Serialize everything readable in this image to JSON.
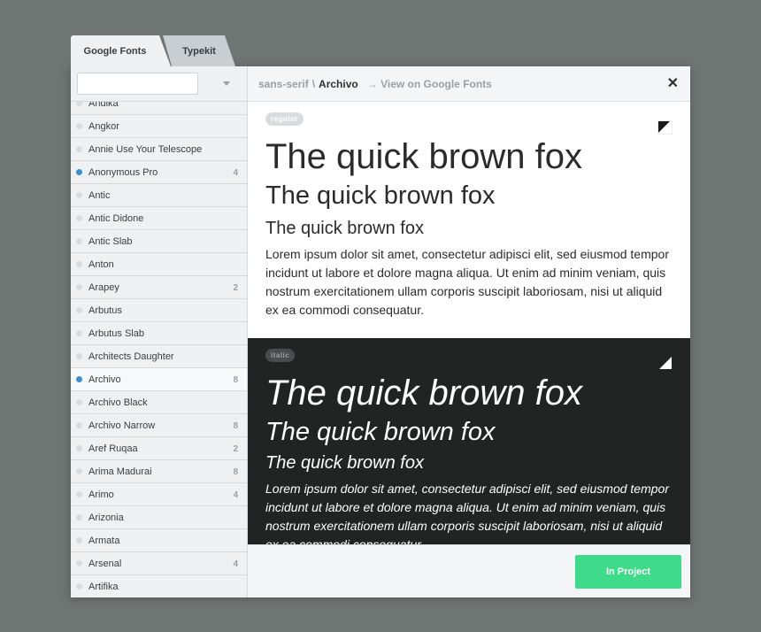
{
  "tabs": [
    {
      "label": "Google Fonts"
    },
    {
      "label": "Typekit"
    }
  ],
  "search": {
    "value": "",
    "placeholder": ""
  },
  "fonts": [
    {
      "name": "Andika",
      "count": "",
      "in_project": false
    },
    {
      "name": "Angkor",
      "count": "",
      "in_project": false
    },
    {
      "name": "Annie Use Your Telescope",
      "count": "",
      "in_project": false
    },
    {
      "name": "Anonymous Pro",
      "count": "4",
      "in_project": true
    },
    {
      "name": "Antic",
      "count": "",
      "in_project": false
    },
    {
      "name": "Antic Didone",
      "count": "",
      "in_project": false
    },
    {
      "name": "Antic Slab",
      "count": "",
      "in_project": false
    },
    {
      "name": "Anton",
      "count": "",
      "in_project": false
    },
    {
      "name": "Arapey",
      "count": "2",
      "in_project": false
    },
    {
      "name": "Arbutus",
      "count": "",
      "in_project": false
    },
    {
      "name": "Arbutus Slab",
      "count": "",
      "in_project": false
    },
    {
      "name": "Architects Daughter",
      "count": "",
      "in_project": false
    },
    {
      "name": "Archivo",
      "count": "8",
      "in_project": true,
      "active": true
    },
    {
      "name": "Archivo Black",
      "count": "",
      "in_project": false
    },
    {
      "name": "Archivo Narrow",
      "count": "8",
      "in_project": false
    },
    {
      "name": "Aref Ruqaa",
      "count": "2",
      "in_project": false
    },
    {
      "name": "Arima Madurai",
      "count": "8",
      "in_project": false
    },
    {
      "name": "Arimo",
      "count": "4",
      "in_project": false
    },
    {
      "name": "Arizonia",
      "count": "",
      "in_project": false
    },
    {
      "name": "Armata",
      "count": "",
      "in_project": false
    },
    {
      "name": "Arsenal",
      "count": "4",
      "in_project": false
    },
    {
      "name": "Artifika",
      "count": "",
      "in_project": false
    }
  ],
  "breadcrumb": {
    "category": "sans-serif",
    "separator": "\\",
    "font": "Archivo",
    "view_link": "→ View on Google Fonts"
  },
  "close_label": "✕",
  "preview": {
    "regular": {
      "badge": "regular",
      "sample_large": "The quick brown fox",
      "sample_medium": "The quick brown fox",
      "sample_small": "The quick brown fox",
      "paragraph": "Lorem ipsum dolor sit amet, consectetur adipisci elit, sed eiusmod tempor incidunt ut labore et dolore magna aliqua. Ut enim ad minim veniam, quis nostrum exercitationem ullam corporis suscipit laboriosam, nisi ut aliquid ex ea commodi consequatur."
    },
    "italic": {
      "badge": "italic",
      "sample_large": "The quick brown fox",
      "sample_medium": "The quick brown fox",
      "sample_small": "The quick brown fox",
      "paragraph": "Lorem ipsum dolor sit amet, consectetur adipisci elit, sed eiusmod tempor incidunt ut labore et dolore magna aliqua. Ut enim ad minim veniam, quis nostrum exercitationem ullam corporis suscipit laboriosam, nisi ut aliquid ex ea commodi consequatur."
    }
  },
  "footer": {
    "button_label": "In Project"
  },
  "colors": {
    "accent_green": "#3edb8a",
    "active_dot": "#3d8ed9",
    "italic_bg": "#222323"
  },
  "icons": {
    "filter": "chevron-down-icon",
    "close": "close-icon",
    "corner_regular": "corner-triangle-icon",
    "corner_italic": "corner-triangle-icon"
  }
}
